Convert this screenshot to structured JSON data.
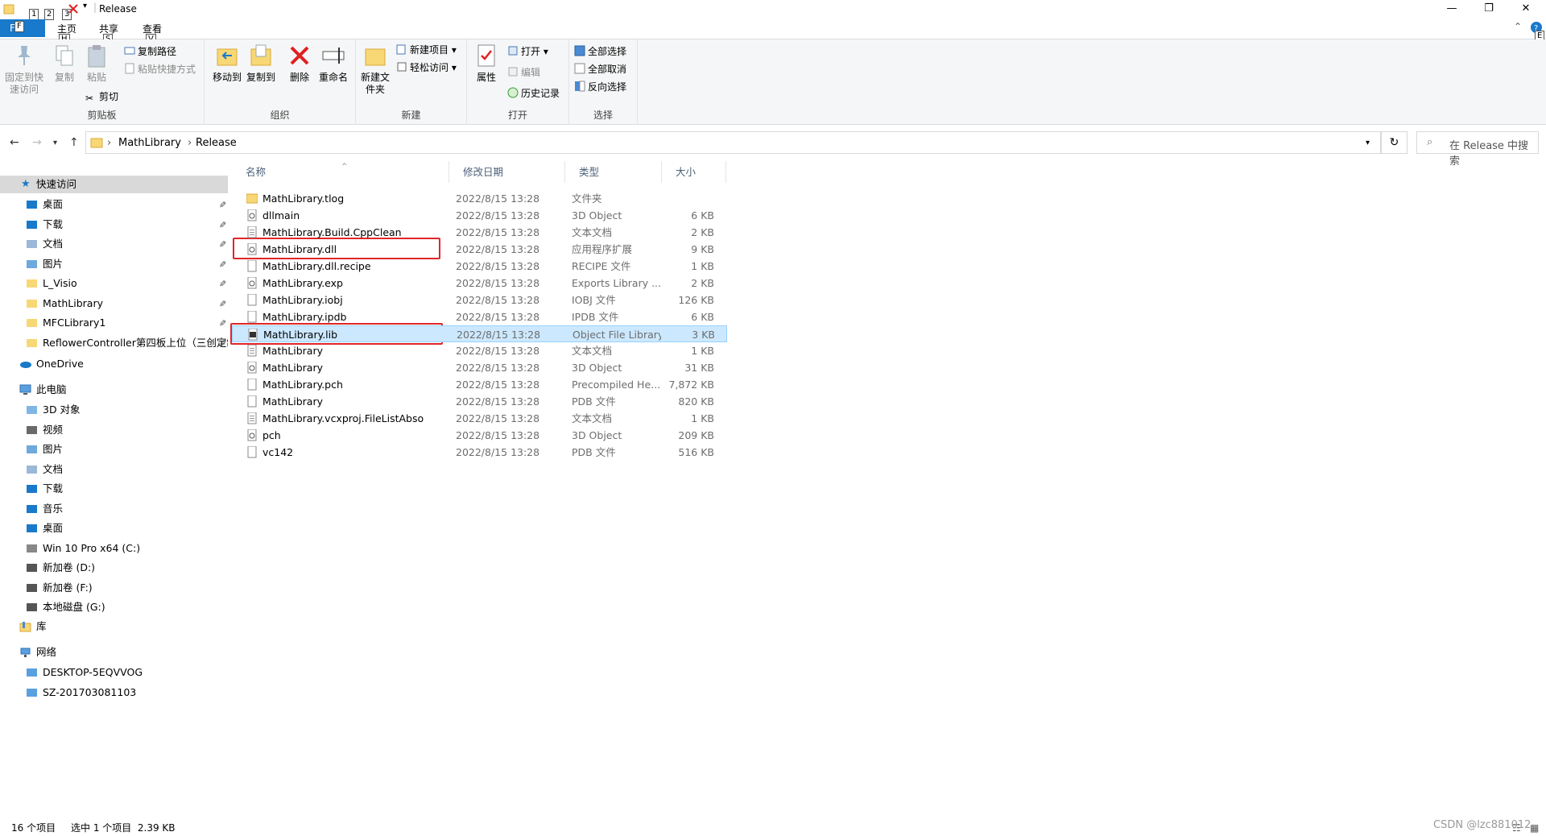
{
  "titlebar": {
    "title": "Release",
    "keytips": [
      "1",
      "2",
      "3"
    ],
    "minimize": "—",
    "restore": "❐",
    "close": "✕"
  },
  "ribbon_tabs": {
    "file": "F",
    "file_keytip": "F",
    "home": "主页",
    "home_keytip": "H",
    "share": "共享",
    "share_keytip": "S",
    "view": "查看",
    "view_keytip": "V",
    "help_keytip": "E"
  },
  "ribbon": {
    "clipboard": {
      "label": "剪贴板",
      "pin_quick_access": "固定到快速访问",
      "copy": "复制",
      "paste": "粘贴",
      "copy_path": "复制路径",
      "paste_shortcut": "粘贴快捷方式",
      "cut": "剪切"
    },
    "organize": {
      "label": "组织",
      "move_to": "移动到",
      "copy_to": "复制到",
      "delete": "删除",
      "rename": "重命名"
    },
    "new": {
      "label": "新建",
      "new_folder": "新建文件夹",
      "new_item": "新建项目",
      "easy_access": "轻松访问"
    },
    "open": {
      "label": "打开",
      "properties": "属性",
      "open": "打开",
      "edit": "编辑",
      "history": "历史记录"
    },
    "select": {
      "label": "选择",
      "select_all": "全部选择",
      "select_none": "全部取消",
      "invert": "反向选择"
    }
  },
  "address": {
    "crumbs": [
      "MathLibrary",
      "Release"
    ],
    "search_placeholder": "在 Release 中搜索"
  },
  "sidebar": {
    "quick_access": "快速访问",
    "quick_items": [
      "桌面",
      "下载",
      "文档",
      "图片",
      "L_Visio",
      "MathLibrary",
      "MFCLibrary1",
      "ReflowerController第四板上位（三创定制"
    ],
    "onedrive": "OneDrive",
    "this_pc": "此电脑",
    "pc_items": [
      "3D 对象",
      "视频",
      "图片",
      "文档",
      "下载",
      "音乐",
      "桌面",
      "Win 10 Pro x64 (C:)",
      "新加卷 (D:)",
      "新加卷 (F:)",
      "本地磁盘 (G:)"
    ],
    "libraries": "库",
    "network": "网络",
    "network_items": [
      "DESKTOP-5EQVVOG",
      "SZ-201703081103"
    ]
  },
  "columns": {
    "name": "名称",
    "date": "修改日期",
    "type": "类型",
    "size": "大小"
  },
  "files": [
    {
      "name": "MathLibrary.tlog",
      "date": "2022/8/15 13:28",
      "type": "文件夹",
      "size": "",
      "icon": "folder"
    },
    {
      "name": "dllmain",
      "date": "2022/8/15 13:28",
      "type": "3D Object",
      "size": "6 KB",
      "icon": "obj"
    },
    {
      "name": "MathLibrary.Build.CppClean",
      "date": "2022/8/15 13:28",
      "type": "文本文档",
      "size": "2 KB",
      "icon": "txt"
    },
    {
      "name": "MathLibrary.dll",
      "date": "2022/8/15 13:28",
      "type": "应用程序扩展",
      "size": "9 KB",
      "icon": "dll"
    },
    {
      "name": "MathLibrary.dll.recipe",
      "date": "2022/8/15 13:28",
      "type": "RECIPE 文件",
      "size": "1 KB",
      "icon": "blank"
    },
    {
      "name": "MathLibrary.exp",
      "date": "2022/8/15 13:28",
      "type": "Exports Library ...",
      "size": "2 KB",
      "icon": "exp"
    },
    {
      "name": "MathLibrary.iobj",
      "date": "2022/8/15 13:28",
      "type": "IOBJ 文件",
      "size": "126 KB",
      "icon": "blank"
    },
    {
      "name": "MathLibrary.ipdb",
      "date": "2022/8/15 13:28",
      "type": "IPDB 文件",
      "size": "6 KB",
      "icon": "blank"
    },
    {
      "name": "MathLibrary.lib",
      "date": "2022/8/15 13:28",
      "type": "Object File Library",
      "size": "3 KB",
      "icon": "lib"
    },
    {
      "name": "MathLibrary",
      "date": "2022/8/15 13:28",
      "type": "文本文档",
      "size": "1 KB",
      "icon": "txt"
    },
    {
      "name": "MathLibrary",
      "date": "2022/8/15 13:28",
      "type": "3D Object",
      "size": "31 KB",
      "icon": "obj"
    },
    {
      "name": "MathLibrary.pch",
      "date": "2022/8/15 13:28",
      "type": "Precompiled He...",
      "size": "7,872 KB",
      "icon": "pch"
    },
    {
      "name": "MathLibrary",
      "date": "2022/8/15 13:28",
      "type": "PDB 文件",
      "size": "820 KB",
      "icon": "blank"
    },
    {
      "name": "MathLibrary.vcxproj.FileListAbsolute",
      "date": "2022/8/15 13:28",
      "type": "文本文档",
      "size": "1 KB",
      "icon": "txt"
    },
    {
      "name": "pch",
      "date": "2022/8/15 13:28",
      "type": "3D Object",
      "size": "209 KB",
      "icon": "obj"
    },
    {
      "name": "vc142",
      "date": "2022/8/15 13:28",
      "type": "PDB 文件",
      "size": "516 KB",
      "icon": "blank"
    }
  ],
  "status": {
    "count": "16 个项目",
    "selection": "选中 1 个项目  2.39 KB"
  },
  "watermark": "CSDN @lzc881012",
  "colors": {
    "accent": "#1979ca",
    "selection_bg": "#cce8ff",
    "highlight_box": "#e0262a"
  }
}
